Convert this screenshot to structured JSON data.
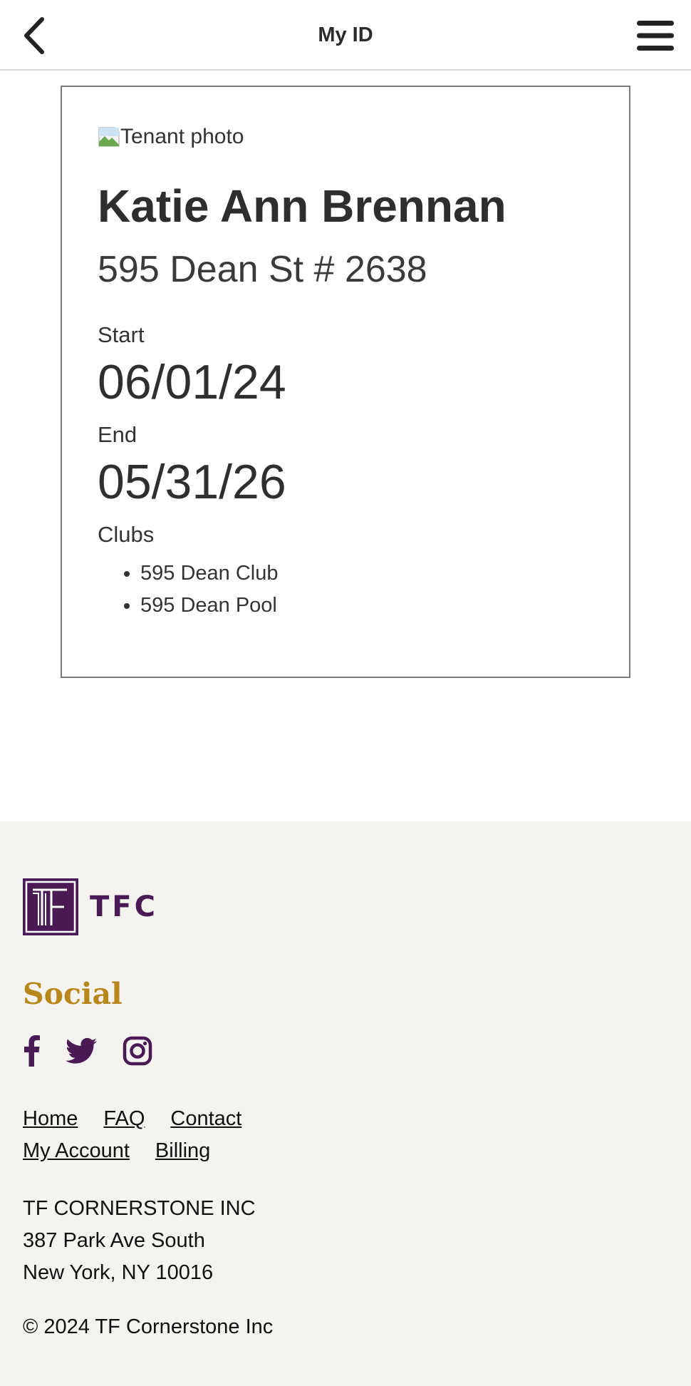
{
  "header": {
    "title": "My ID",
    "back_icon": "chevron-left-icon",
    "menu_icon": "hamburger-menu-icon"
  },
  "card": {
    "photo_alt": "Tenant photo",
    "name": "Katie Ann Brennan",
    "unit": "595 Dean St # 2638",
    "start_label": "Start",
    "start_date": "06/01/24",
    "end_label": "End",
    "end_date": "05/31/26",
    "clubs_label": "Clubs",
    "clubs": [
      "595 Dean Club",
      "595 Dean Pool"
    ]
  },
  "footer": {
    "logo_text": "TFC",
    "social_heading": "Social",
    "social_icons": [
      "facebook-icon",
      "twitter-icon",
      "instagram-icon"
    ],
    "links_row1": [
      "Home",
      "FAQ",
      "Contact"
    ],
    "links_row2": [
      "My Account",
      "Billing"
    ],
    "address": [
      "TF CORNERSTONE INC",
      "387 Park Ave South",
      "New York, NY 10016"
    ],
    "copyright": "© 2024 TF Cornerstone Inc"
  },
  "colors": {
    "brand_purple": "#4a1a55",
    "social_gold": "#b8871a",
    "footer_bg": "#f4f3f0"
  }
}
